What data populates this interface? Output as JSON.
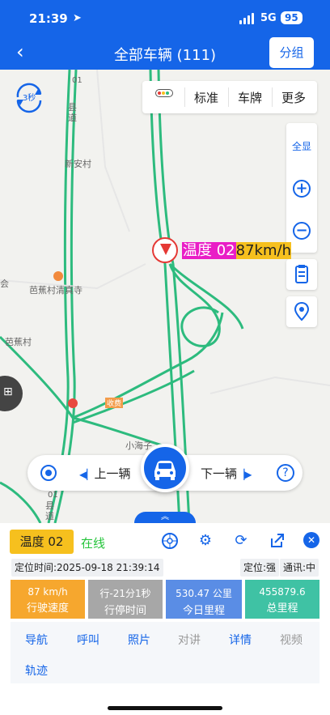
{
  "status_bar": {
    "time": "21:39",
    "location_icon": "location-arrow-icon",
    "network": "5G",
    "battery": "95"
  },
  "header": {
    "back_icon": "chevron-left-icon",
    "title": "全部车辆 (111)",
    "group_button": "分组"
  },
  "map": {
    "refresh_interval": "3秒",
    "tabs": {
      "standard": "标准",
      "plate": "车牌",
      "more": "更多"
    },
    "tools": {
      "fit_all": "全显",
      "zoom_in": "+",
      "zoom_out": "−"
    },
    "labels": {
      "xinan_village": "新安村",
      "bajiao_temple": "芭蕉村清真寺",
      "bajiao_village": "芭蕉村",
      "xiaohaizi": "小海子",
      "toll": "收费",
      "county_road_top": "县道",
      "county_road_bottom": "县道",
      "county_road_num": "01",
      "county_road_num_bottom": "01",
      "edge_text": "会"
    },
    "vehicle_label": {
      "name": "温度 02",
      "speed": "87km/h"
    },
    "nav": {
      "prev": "上一辆",
      "next": "下一辆",
      "help": "?"
    }
  },
  "panel": {
    "vehicle_name": "温度 02",
    "online_status": "在线",
    "locate_time": "定位时间:2025-09-18 21:39:14",
    "locate_quality": "定位:强",
    "comm_quality": "通讯:中",
    "stats": [
      {
        "value": "87 km/h",
        "label": "行驶速度",
        "color": "#f6a72e"
      },
      {
        "value": "行-21分1秒",
        "label": "行停时间",
        "color": "#a7a7a7"
      },
      {
        "value": "530.47 公里",
        "label": "今日里程",
        "color": "#5a8de5"
      },
      {
        "value": "455879.6",
        "label": "总里程",
        "color": "#3fc2a4"
      }
    ],
    "actions": {
      "navigate": "导航",
      "call": "呼叫",
      "photo": "照片",
      "intercom": "对讲",
      "details": "详情",
      "video": "视频",
      "track": "轨迹"
    }
  },
  "colors": {
    "primary": "#1565e8",
    "road_green": "#2dbb7e",
    "vehicle_name_bg": "#f6c01e",
    "label_magenta": "#e91ec6",
    "online_green": "#25c43b"
  }
}
